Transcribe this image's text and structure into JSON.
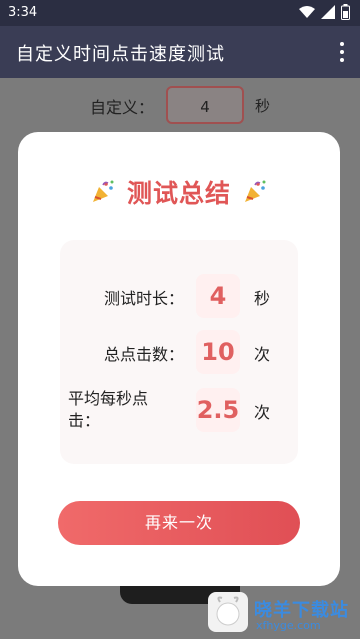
{
  "status_bar": {
    "time": "3:34"
  },
  "app_bar": {
    "title": "自定义时间点击速度测试"
  },
  "background": {
    "custom_label": "自定义：",
    "custom_value": "4",
    "custom_unit": "秒"
  },
  "dialog": {
    "title": "测试总结",
    "rows": [
      {
        "label": "测试时长：",
        "value": "4",
        "unit": "秒"
      },
      {
        "label": "总点击数：",
        "value": "10",
        "unit": "次"
      },
      {
        "label_line1": "平均每秒点",
        "label_line2": "击：",
        "value": "2.5",
        "unit": "次"
      }
    ],
    "button_label": "再来一次"
  },
  "watermark": {
    "text": "晓羊下载站",
    "url": "xfhyge.com"
  },
  "colors": {
    "accent": "#e05656",
    "appbar": "#3a3d55"
  }
}
